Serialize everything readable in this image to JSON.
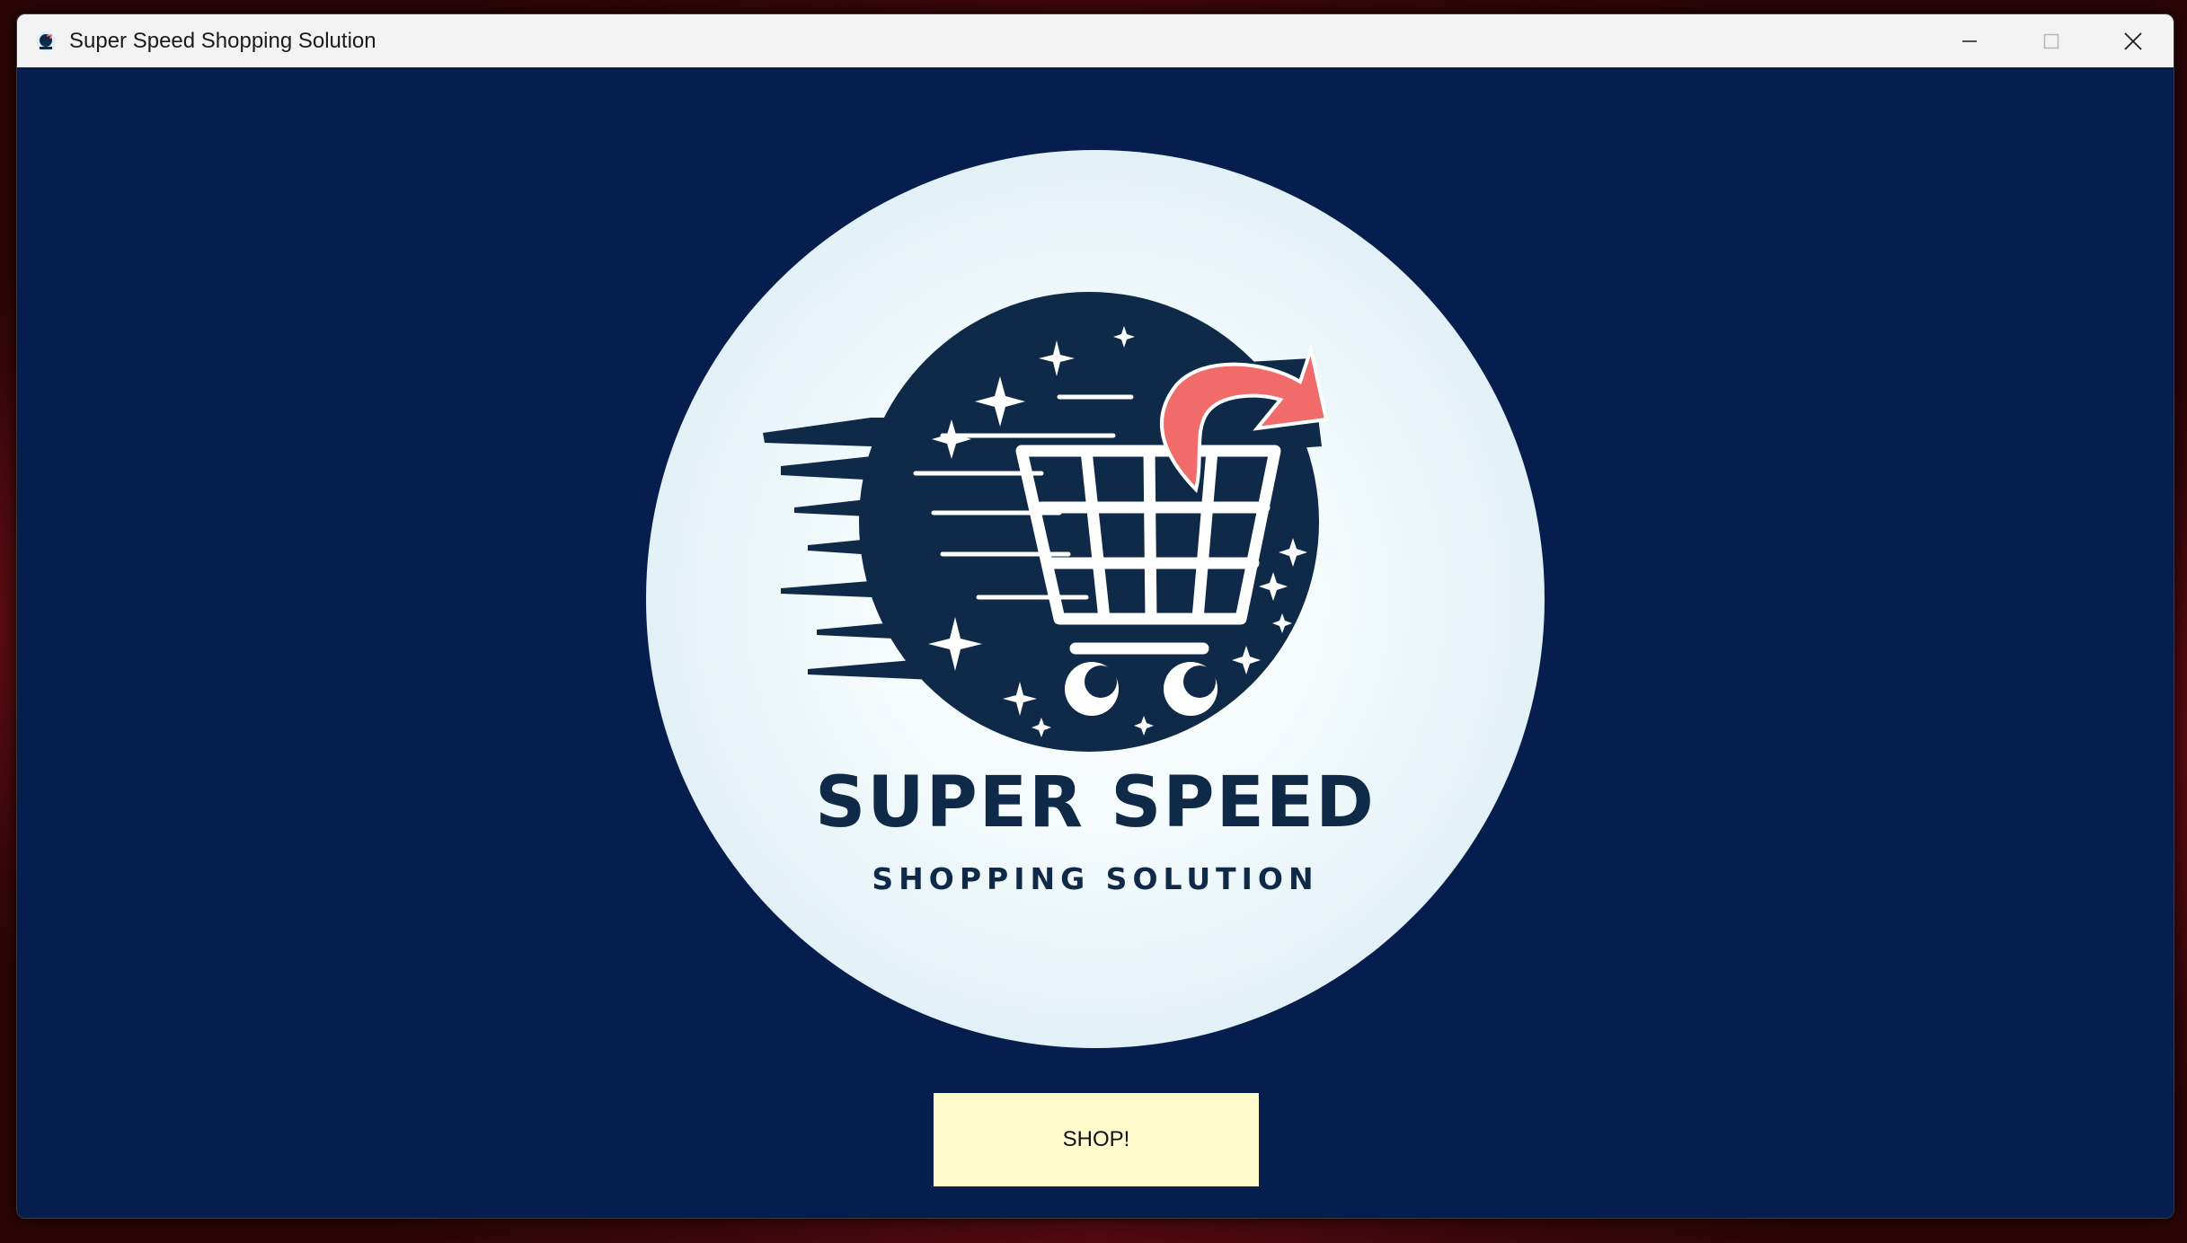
{
  "window": {
    "title": "Super Speed Shopping Solution",
    "icon": "app-logo-icon",
    "controls": {
      "minimize": "minimize-icon",
      "maximize": "maximize-icon",
      "close": "close-icon"
    }
  },
  "logo": {
    "title": "SUPER SPEED",
    "subtitle": "SHOPPING SOLUTION",
    "colors": {
      "navy": "#0f2a48",
      "arrow": "#f26b6b",
      "circle": "#e6f3f8"
    }
  },
  "main": {
    "shop_button_label": "SHOP!"
  },
  "theme": {
    "background": "#061e4d",
    "button_bg": "#fffbcc",
    "titlebar_bg": "#f3f3f3"
  }
}
